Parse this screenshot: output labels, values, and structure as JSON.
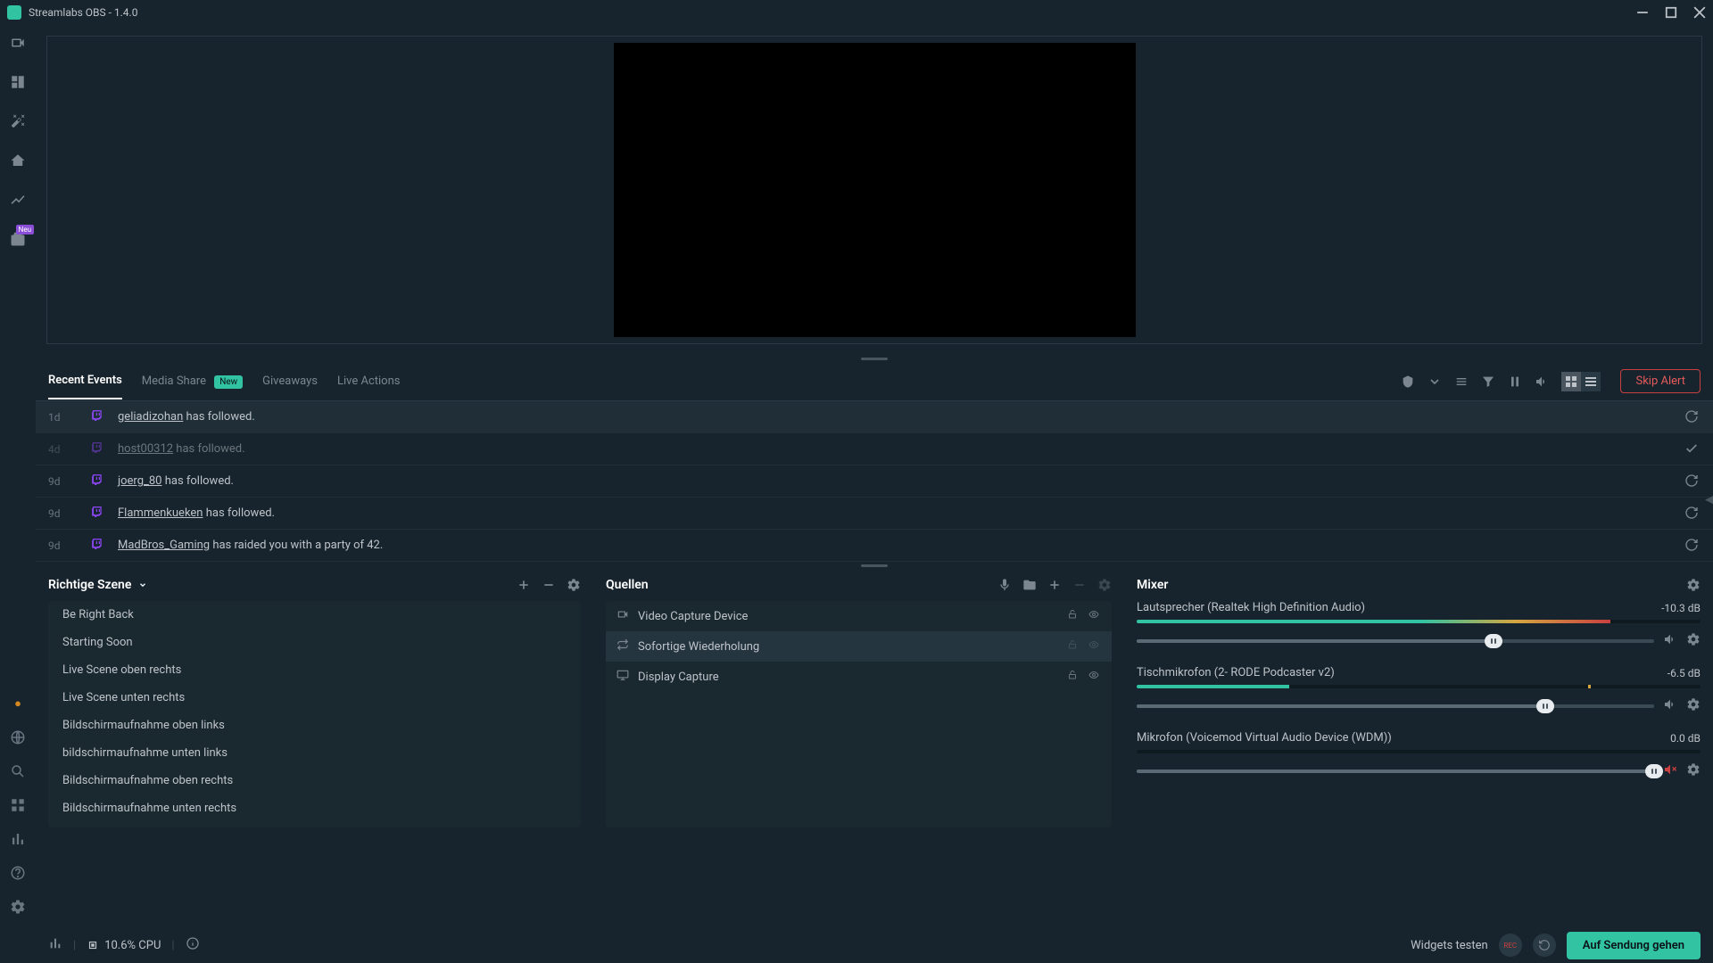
{
  "titlebar": {
    "title": "Streamlabs OBS - 1.4.0"
  },
  "sidebar": {
    "badge_new": "Neu"
  },
  "events": {
    "tabs": {
      "recent": "Recent Events",
      "media_share": "Media Share",
      "media_share_badge": "New",
      "giveaways": "Giveaways",
      "live_actions": "Live Actions"
    },
    "skip_alert": "Skip Alert",
    "rows": [
      {
        "time": "1d",
        "user": "geliadizohan",
        "action": " has followed.",
        "icon_action": "refresh",
        "dim": false,
        "hovered": true
      },
      {
        "time": "4d",
        "user": "host00312",
        "action": " has followed.",
        "icon_action": "check",
        "dim": true,
        "hovered": false
      },
      {
        "time": "9d",
        "user": "joerg_80",
        "action": " has followed.",
        "icon_action": "refresh",
        "dim": false,
        "hovered": false
      },
      {
        "time": "9d",
        "user": "Flammenkueken",
        "action": " has followed.",
        "icon_action": "refresh",
        "dim": false,
        "hovered": false
      },
      {
        "time": "9d",
        "user": "MadBros_Gaming",
        "action": " has raided you with a party of 42.",
        "icon_action": "refresh",
        "dim": false,
        "hovered": false
      }
    ]
  },
  "scenes": {
    "title": "Richtige Szene",
    "items": [
      "Be Right Back",
      "Starting Soon",
      "Live Scene oben rechts",
      "Live Scene unten rechts",
      "Bildschirmaufnahme oben links",
      "bildschirmaufnahme unten links",
      "Bildschirmaufnahme oben rechts",
      "Bildschirmaufnahme unten rechts"
    ]
  },
  "sources": {
    "title": "Quellen",
    "items": [
      {
        "icon": "camera",
        "name": "Video Capture Device",
        "selected": false,
        "dim_vis": false
      },
      {
        "icon": "loop",
        "name": "Sofortige Wiederholung",
        "selected": true,
        "dim_vis": true
      },
      {
        "icon": "display",
        "name": "Display Capture",
        "selected": false,
        "dim_vis": false
      }
    ]
  },
  "mixer": {
    "title": "Mixer",
    "channels": [
      {
        "name": "Lautsprecher (Realtek High Definition Audio)",
        "db": "-10.3 dB",
        "meter": 84,
        "thumb": 69,
        "muted": false,
        "meter_style": "gradient"
      },
      {
        "name": "Tischmikrofon (2- RODE Podcaster v2)",
        "db": "-6.5 dB",
        "meter": 27,
        "thumb": 79,
        "muted": false,
        "meter_style": "green",
        "dot": 80
      },
      {
        "name": "Mikrofon (Voicemod Virtual Audio Device (WDM))",
        "db": "0.0 dB",
        "meter": 0,
        "thumb": 100,
        "muted": true,
        "meter_style": "none"
      }
    ]
  },
  "status": {
    "cpu": "10.6% CPU",
    "test_widgets": "Widgets testen",
    "go_live": "Auf Sendung gehen",
    "rec_label": "REC"
  }
}
